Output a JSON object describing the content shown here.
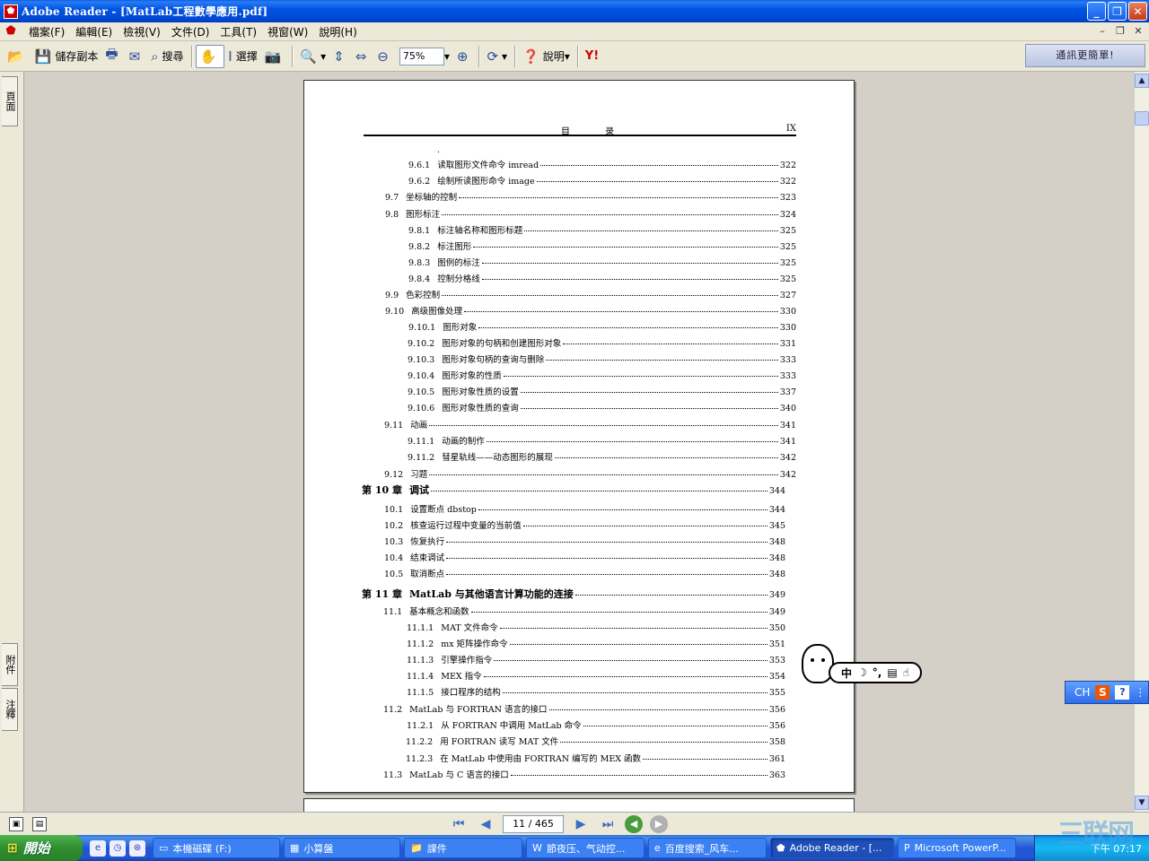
{
  "window": {
    "title": "Adobe Reader - [MatLab工程數學應用.pdf]",
    "app_icon": "adobe-reader-icon"
  },
  "menu": {
    "items": [
      "檔案(F)",
      "編輯(E)",
      "檢視(V)",
      "文件(D)",
      "工具(T)",
      "視窗(W)",
      "說明(H)"
    ]
  },
  "toolbar": {
    "save_copy": "儲存副本",
    "search": "搜尋",
    "select": "選擇",
    "zoom_value": "75%",
    "help": "說明",
    "yahoo": "Y!",
    "ad_text": "通訊更簡單!"
  },
  "nav_tabs": {
    "pages": "頁面",
    "attachments": "附件",
    "comments": "注釋"
  },
  "page_header": {
    "title": "目 录",
    "number": "IX"
  },
  "toc": [
    {
      "num": ".",
      "text": "",
      "page": ""
    },
    {
      "num": "9.6.1",
      "text": "读取图形文件命令 imread",
      "page": "322"
    },
    {
      "num": "9.6.2",
      "text": "绘制所读图形命令 image",
      "page": "322"
    },
    {
      "num": "9.7",
      "text": "坐标轴的控制",
      "page": "323"
    },
    {
      "num": "9.8",
      "text": "图形标注",
      "page": "324"
    },
    {
      "num": "9.8.1",
      "text": "标注轴名称和图形标题",
      "page": "325"
    },
    {
      "num": "9.8.2",
      "text": "标注图形",
      "page": "325"
    },
    {
      "num": "9.8.3",
      "text": "图例的标注",
      "page": "325"
    },
    {
      "num": "9.8.4",
      "text": "控制分格线",
      "page": "325"
    },
    {
      "num": "9.9",
      "text": "色彩控制",
      "page": "327"
    },
    {
      "num": "9.10",
      "text": "高级图像处理",
      "page": "330"
    },
    {
      "num": "9.10.1",
      "text": "图形对象",
      "page": "330"
    },
    {
      "num": "9.10.2",
      "text": "图形对象的句柄和创建图形对象",
      "page": "331"
    },
    {
      "num": "9.10.3",
      "text": "图形对象句柄的查询与删除",
      "page": "333"
    },
    {
      "num": "9.10.4",
      "text": "图形对象的性质",
      "page": "333"
    },
    {
      "num": "9.10.5",
      "text": "图形对象性质的设置",
      "page": "337"
    },
    {
      "num": "9.10.6",
      "text": "图形对象性质的查询",
      "page": "340"
    },
    {
      "num": "9.11",
      "text": "动画",
      "page": "341"
    },
    {
      "num": "9.11.1",
      "text": "动画的制作",
      "page": "341"
    },
    {
      "num": "9.11.2",
      "text": "彗星轨线——动态图形的展现",
      "page": "342"
    },
    {
      "num": "9.12",
      "text": "习题",
      "page": "342"
    },
    {
      "num": "第 10 章",
      "text": "调试",
      "page": "344"
    },
    {
      "num": "10.1",
      "text": "设置断点 dbstop",
      "page": "344"
    },
    {
      "num": "10.2",
      "text": "核查运行过程中变量的当前值",
      "page": "345"
    },
    {
      "num": "10.3",
      "text": "恢复执行",
      "page": "348"
    },
    {
      "num": "10.4",
      "text": "结束调试",
      "page": "348"
    },
    {
      "num": "10.5",
      "text": "取消断点",
      "page": "348"
    },
    {
      "num": "第 11 章",
      "text": "MatLab 与其他语言计算功能的连接",
      "page": "349"
    },
    {
      "num": "11.1",
      "text": "基本概念和函数",
      "page": "349"
    },
    {
      "num": "11.1.1",
      "text": "MAT 文件命令",
      "page": "350"
    },
    {
      "num": "11.1.2",
      "text": "mx 矩阵操作命令",
      "page": "351"
    },
    {
      "num": "11.1.3",
      "text": "引擎操作指令",
      "page": "353"
    },
    {
      "num": "11.1.4",
      "text": "MEX 指令",
      "page": "354"
    },
    {
      "num": "11.1.5",
      "text": "接口程序的结构",
      "page": "355"
    },
    {
      "num": "11.2",
      "text": "MatLab 与 FORTRAN 语言的接口",
      "page": "356"
    },
    {
      "num": "11.2.1",
      "text": "从 FORTRAN 中调用 MatLab 命令",
      "page": "356"
    },
    {
      "num": "11.2.2",
      "text": "用 FORTRAN 读写 MAT 文件",
      "page": "358"
    },
    {
      "num": "11.2.3",
      "text": "在 MatLab 中使用由 FORTRAN 编写的 MEX 函数",
      "page": "361"
    },
    {
      "num": "11.3",
      "text": "MatLab 与 C 语言的接口",
      "page": "363"
    }
  ],
  "page_nav": {
    "page_indicator": "11 / 465"
  },
  "ime": {
    "mascot_label": "中",
    "bar_label": "CH",
    "s_icon": "S",
    "help_icon": "?"
  },
  "taskbar": {
    "start": "開始",
    "tasks": [
      {
        "label": "本機磁碟 (F:)",
        "icon": "drive-icon"
      },
      {
        "label": "小算盤",
        "icon": "calculator-icon"
      },
      {
        "label": "課件",
        "icon": "folder-icon"
      },
      {
        "label": "節夜压、气动控...",
        "icon": "word-icon"
      },
      {
        "label": "百度搜索_风车...",
        "icon": "ie-icon"
      },
      {
        "label": "Adobe Reader - [...",
        "icon": "adobe-reader-icon"
      },
      {
        "label": "Microsoft PowerP...",
        "icon": "powerpoint-icon"
      }
    ],
    "clock": "下午 07:17"
  },
  "watermark": "三联网"
}
